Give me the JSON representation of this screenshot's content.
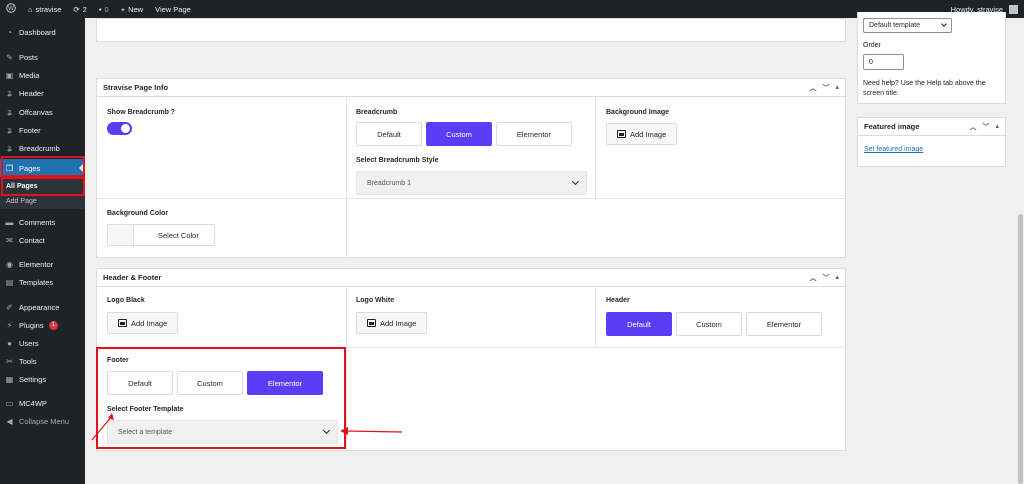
{
  "adminbar": {
    "site_name": "stravise",
    "updates_count": "2",
    "comments_count": "0",
    "new_label": "New",
    "view_page_label": "View Page",
    "howdy": "Howdy, stravise"
  },
  "sidebar": {
    "items": [
      {
        "label": "Dashboard",
        "icon": "dashboard-icon"
      },
      {
        "label": "Posts",
        "icon": "pin-icon"
      },
      {
        "label": "Media",
        "icon": "media-icon"
      },
      {
        "label": "Header",
        "icon": "elementor-kit-icon"
      },
      {
        "label": "Offcanvas",
        "icon": "elementor-kit-icon"
      },
      {
        "label": "Footer",
        "icon": "elementor-kit-icon"
      },
      {
        "label": "Breadcrumb",
        "icon": "elementor-kit-icon"
      },
      {
        "label": "Pages",
        "icon": "pages-icon"
      },
      {
        "label": "Comments",
        "icon": "comment-icon"
      },
      {
        "label": "Contact",
        "icon": "mail-icon"
      },
      {
        "label": "Elementor",
        "icon": "elementor-icon"
      },
      {
        "label": "Templates",
        "icon": "folder-icon"
      },
      {
        "label": "Appearance",
        "icon": "brush-icon"
      },
      {
        "label": "Plugins",
        "icon": "plug-icon",
        "badge": "1"
      },
      {
        "label": "Users",
        "icon": "user-icon"
      },
      {
        "label": "Tools",
        "icon": "wrench-icon"
      },
      {
        "label": "Settings",
        "icon": "settings-icon"
      },
      {
        "label": "MC4WP",
        "icon": "mc4wp-icon"
      },
      {
        "label": "Collapse Menu",
        "icon": "collapse-icon"
      }
    ],
    "submenu": [
      {
        "label": "All Pages"
      },
      {
        "label": "Add Page"
      }
    ]
  },
  "page_info": {
    "title": "Stravise Page Info",
    "show_breadcrumb_label": "Show Breadcrumb ?",
    "breadcrumb_label": "Breadcrumb",
    "breadcrumb_options": [
      "Default",
      "Custom",
      "Elementor"
    ],
    "breadcrumb_style_label": "Select Breadcrumb Style",
    "breadcrumb_style_value": "Breadcrumb 1",
    "background_image_label": "Background Image",
    "add_image_label": "Add Image",
    "background_color_label": "Background Color",
    "select_color_label": "Select Color"
  },
  "header_footer": {
    "title": "Header & Footer",
    "logo_black_label": "Logo Black",
    "logo_white_label": "Logo White",
    "add_image_label": "Add Image",
    "header_label": "Header",
    "header_options": [
      "Default",
      "Custom",
      "Elementor"
    ],
    "footer_label": "Footer",
    "footer_options": [
      "Default",
      "Custom",
      "Elementor"
    ],
    "footer_template_label": "Select Footer Template",
    "footer_template_placeholder": "Select a template"
  },
  "side": {
    "template_value": "Default template",
    "order_label": "Order",
    "order_value": "0",
    "help_text": "Need help? Use the Help tab above the screen title.",
    "featured_image_title": "Featured image",
    "set_featured_image": "Set featured image"
  },
  "colors": {
    "accent": "#5b3df5",
    "wp_blue": "#2271b1",
    "annotation_red": "#e1121b"
  }
}
